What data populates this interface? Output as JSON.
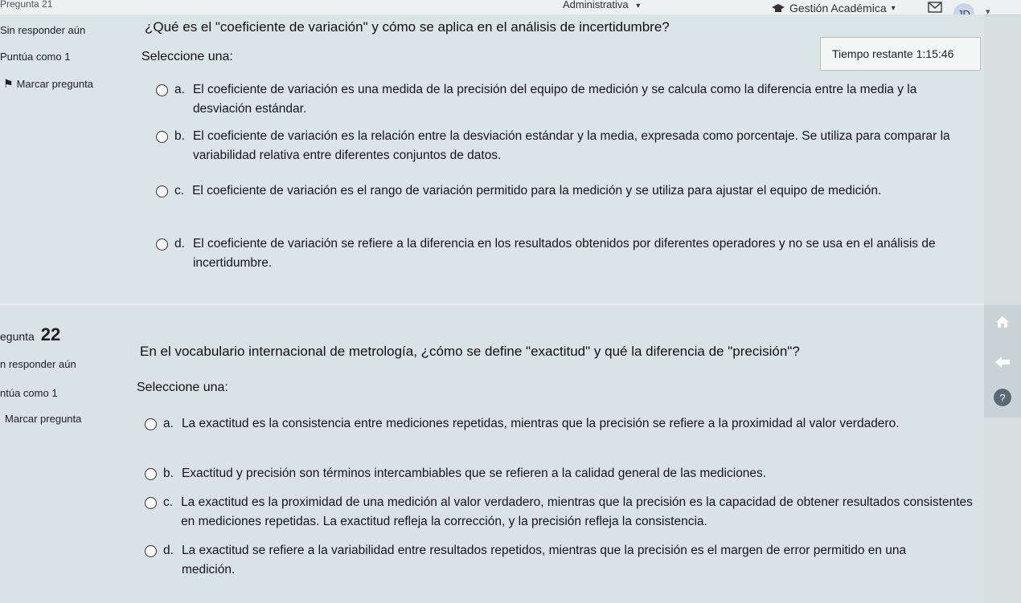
{
  "topbar": {
    "prev_question_label": "Pregunta 21",
    "admin_label": "Administrativa",
    "gestion_label": "Gestión Académica",
    "avatar_initials": "JD"
  },
  "q21": {
    "status": "Sin responder aún",
    "score": "Puntúa como 1",
    "flag_label": "Marcar pregunta",
    "question": "¿Qué es el \"coeficiente de variación\" y cómo se aplica en el análisis de incertidumbre?",
    "select_label": "Seleccione una:",
    "timer_label": "Tiempo restante",
    "timer_value": "1:15:46",
    "options": [
      {
        "letter": "a.",
        "text": "El coeficiente de variación es una medida de la precisión del equipo de medición y se calcula como la diferencia entre la media y la desviación estándar."
      },
      {
        "letter": "b.",
        "text": "El coeficiente de variación es la relación entre la desviación estándar y la media, expresada como porcentaje. Se utiliza para comparar la variabilidad relativa entre diferentes conjuntos de datos."
      },
      {
        "letter": "c.",
        "text": "El coeficiente de variación es el rango de variación permitido para la medición y se utiliza para ajustar el equipo de medición."
      },
      {
        "letter": "d.",
        "text": "El coeficiente de variación se refiere a la diferencia en los resultados obtenidos por diferentes operadores y no se usa en el análisis de incertidumbre."
      }
    ]
  },
  "q22": {
    "title_prefix": "egunta",
    "number": "22",
    "status": "n responder aún",
    "score": "ntúa como 1",
    "flag_label": "Marcar pregunta",
    "question": "En el vocabulario internacional de metrología, ¿cómo se define \"exactitud\" y qué la diferencia de \"precisión\"?",
    "select_label": "Seleccione una:",
    "options": [
      {
        "letter": "a.",
        "text": "La exactitud es la consistencia entre mediciones repetidas, mientras que la precisión se refiere a la proximidad al valor verdadero."
      },
      {
        "letter": "b.",
        "text": "Exactitud y precisión son términos intercambiables que se refieren a la calidad general de las mediciones."
      },
      {
        "letter": "c.",
        "text": "La exactitud es la proximidad de una medición al valor verdadero, mientras que la precisión es la capacidad de obtener resultados consistentes en mediciones repetidas. La exactitud refleja la corrección, y la precisión refleja la consistencia."
      },
      {
        "letter": "d.",
        "text": "La exactitud se refiere a la variabilidad entre resultados repetidos, mientras que la precisión es el margen de error permitido en una medición."
      }
    ]
  },
  "icons": {
    "home": "home-icon",
    "back": "arrow-left-icon",
    "help": "help-icon",
    "flag": "flag-icon"
  },
  "colors": {
    "background": "#d6dee0",
    "timer_bg": "#f4f6f6"
  }
}
